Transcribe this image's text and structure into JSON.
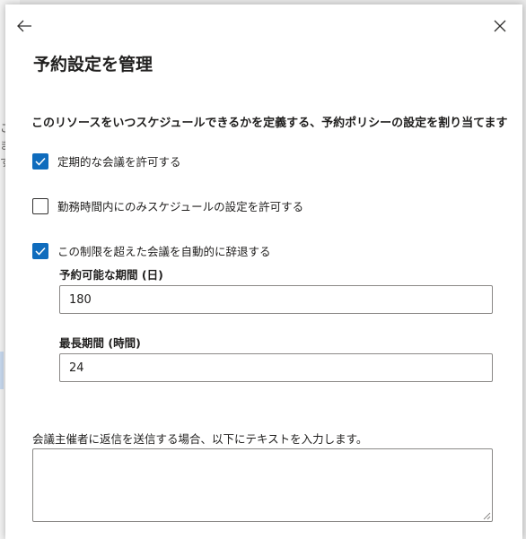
{
  "backdrop": {
    "fragments": [
      "こ",
      "ま",
      "す"
    ]
  },
  "panel": {
    "title": "予約設定を管理",
    "description": "このリソースをいつスケジュールできるかを定義する、予約ポリシーの設定を割り当てます",
    "options": [
      {
        "label": "定期的な会議を許可する",
        "checked": true
      },
      {
        "label": "勤務時間内にのみスケジュールの設定を許可する",
        "checked": false
      },
      {
        "label": "この制限を超えた会議を自動的に辞退する",
        "checked": true
      }
    ],
    "booking_window": {
      "label": "予約可能な期間 (日)",
      "value": "180"
    },
    "max_duration": {
      "label": "最長期間 (時間)",
      "value": "24"
    },
    "reply_message": {
      "label": "会議主催者に返信を送信する場合、以下にテキストを入力します。",
      "value": ""
    }
  },
  "icons": {
    "back": "arrow-left-icon",
    "close": "close-icon"
  },
  "colors": {
    "accent": "#0f6cbd",
    "border": "#8a8886",
    "text": "#201f1e"
  }
}
